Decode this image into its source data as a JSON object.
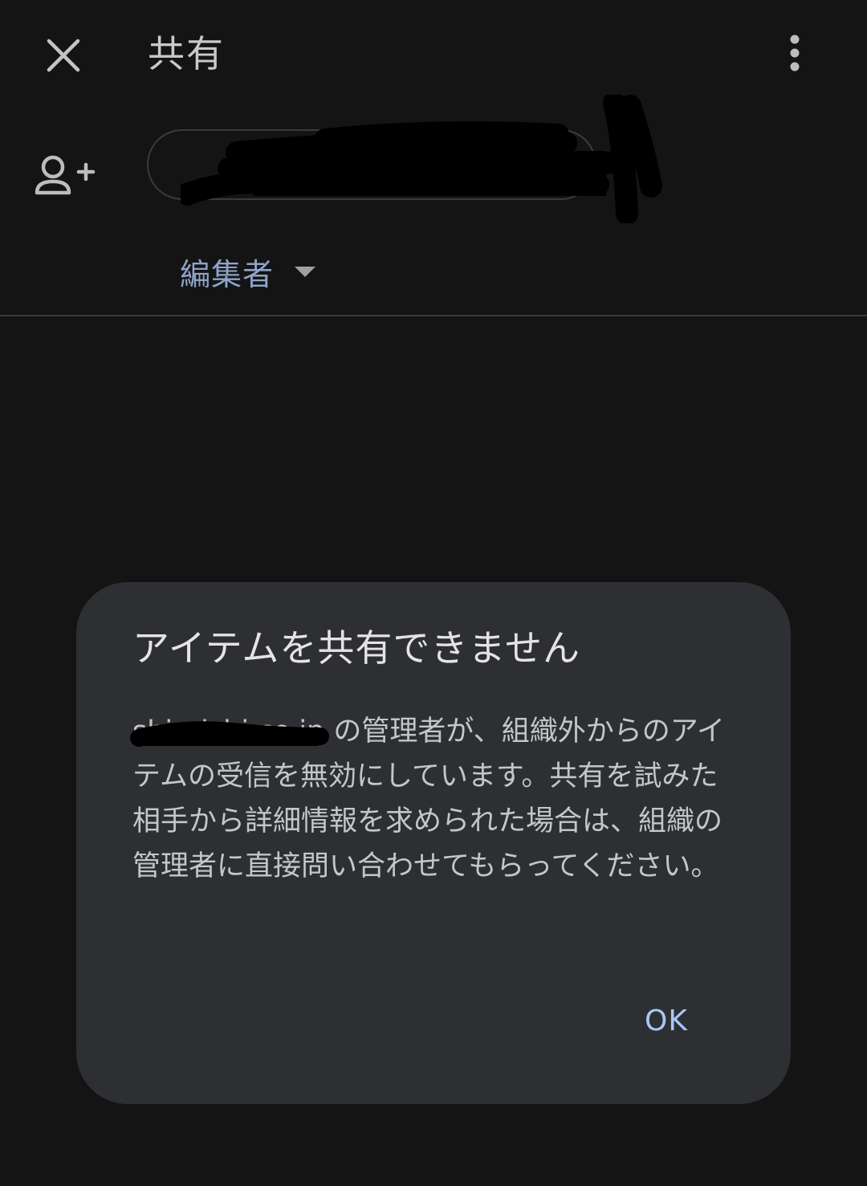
{
  "header": {
    "title": "共有",
    "close_icon": "close-icon",
    "more_icon": "more-vert-icon"
  },
  "recipients": {
    "add_person_icon": "add-person-icon",
    "role_label": "編集者",
    "role_icon": "dropdown-arrow-icon"
  },
  "dialog": {
    "title": "アイテムを共有できません",
    "org_name": "shiroishi.co.jp",
    "body": " の管理者が、組織外からのアイテムの受信を無効にしています。共有を試みた相手から詳細情報を求められた場合は、組織の管理者に直接問い合わせてもらってください。",
    "ok_label": "OK"
  },
  "colors": {
    "background": "#141414",
    "dialog_background": "#2e2f33",
    "accent": "#a8c7fa",
    "role_text": "#8ea3c8",
    "redaction": "#000000"
  }
}
